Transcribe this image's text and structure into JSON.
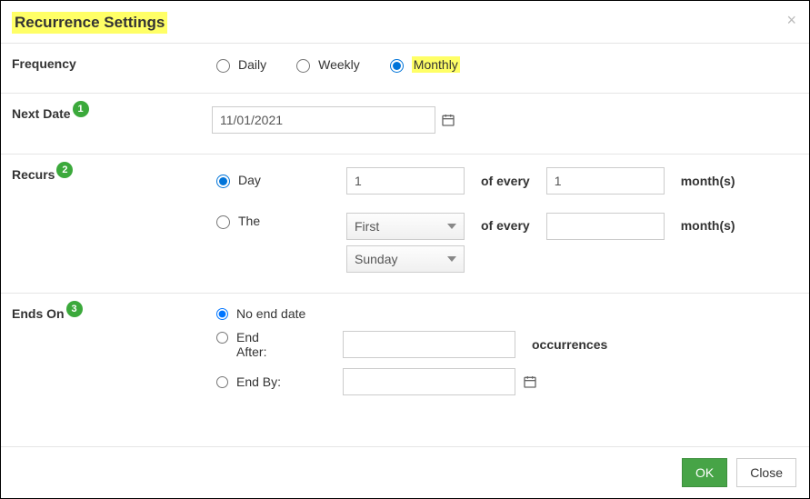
{
  "dialog": {
    "title": "Recurrence Settings",
    "close_glyph": "×"
  },
  "frequency": {
    "label": "Frequency",
    "options": {
      "daily": "Daily",
      "weekly": "Weekly",
      "monthly": "Monthly"
    },
    "selected": "monthly"
  },
  "next_date": {
    "label": "Next Date",
    "badge": "1",
    "value": "11/01/2021"
  },
  "recurs": {
    "label": "Recurs",
    "badge": "2",
    "day_option": {
      "label": "Day",
      "day_value": "1",
      "of_every": "of every",
      "month_value": "1",
      "months_label": "month(s)"
    },
    "the_option": {
      "label": "The",
      "ordinal": "First",
      "weekday": "Sunday",
      "of_every": "of every",
      "month_value": "",
      "months_label": "month(s)"
    }
  },
  "ends_on": {
    "label": "Ends On",
    "badge": "3",
    "no_end": "No end date",
    "end_after": "End After:",
    "end_after_value": "",
    "occurrences": "occurrences",
    "end_by": "End By:",
    "end_by_value": ""
  },
  "footer": {
    "ok": "OK",
    "close": "Close"
  }
}
